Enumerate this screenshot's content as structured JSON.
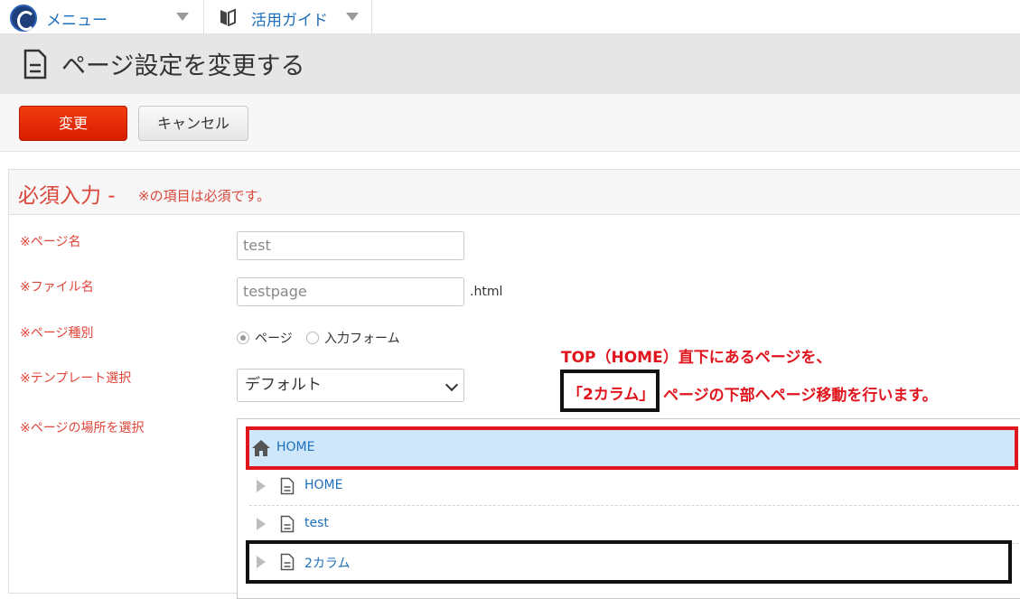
{
  "topbar": {
    "menu_label": "メニュー",
    "guide_label": "活用ガイド"
  },
  "page": {
    "title": "ページ設定を変更する"
  },
  "toolbar": {
    "submit_label": "変更",
    "cancel_label": "キャンセル"
  },
  "section": {
    "title": "必須入力 -",
    "note": "※の項目は必須です。"
  },
  "form": {
    "page_name": {
      "label": "※ページ名",
      "value": "test"
    },
    "file_name": {
      "label": "※ファイル名",
      "value": "testpage",
      "suffix": ".html"
    },
    "page_type": {
      "label": "※ページ種別",
      "options": [
        "ページ",
        "入力フォーム"
      ],
      "selected": "ページ"
    },
    "template": {
      "label": "※テンプレート選択",
      "value": "デフォルト"
    },
    "location": {
      "label": "※ページの場所を選択"
    }
  },
  "tree": {
    "root": "HOME",
    "items": [
      "HOME",
      "test",
      "2カラム"
    ]
  },
  "annotation": {
    "line1": "TOP（HOME）直下にあるページを、",
    "boxed": "「2カラム」",
    "line2": "ページの下部へページ移動を行います。"
  },
  "colors": {
    "accent_red": "#e0151d",
    "link_blue": "#1e6fbd",
    "selected_row": "#cfe7fb",
    "submit_button": "#e82a05"
  },
  "icons": [
    "logo-icon",
    "chevron-down-icon",
    "guide-book-icon",
    "document-icon",
    "home-icon",
    "expand-triangle-icon"
  ]
}
